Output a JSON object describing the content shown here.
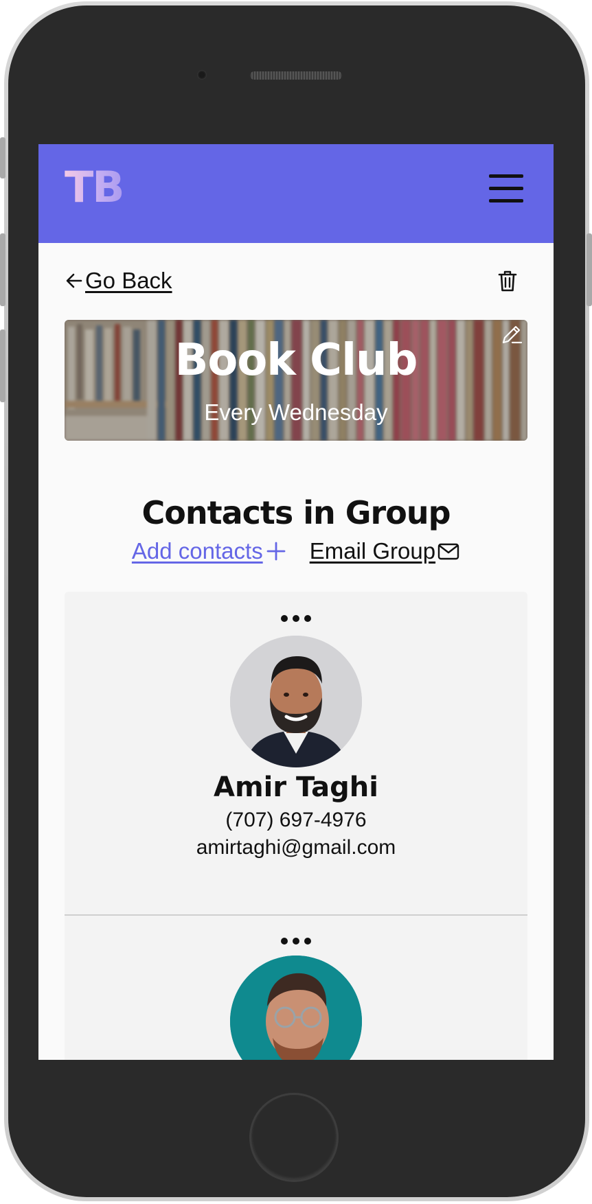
{
  "app": {
    "logo_text": "TB",
    "brand_color": "#6466e6"
  },
  "nav": {
    "back_label": "Go Back",
    "menu_icon": "hamburger-menu-icon",
    "delete_icon": "trash-icon"
  },
  "group": {
    "title": "Book Club",
    "schedule": "Every Wednesday",
    "edit_icon": "pencil-icon"
  },
  "contacts_section": {
    "title": "Contacts in Group",
    "add_label": "Add contacts ",
    "email_label": "Email Group ",
    "add_icon": "plus-icon",
    "email_icon": "envelope-icon"
  },
  "contacts": [
    {
      "name": "Amir Taghi",
      "phone": "(707) 697-4976",
      "email": "amirtaghi@gmail.com",
      "avatar_bg": "#cfcfd3"
    },
    {
      "avatar_bg": "#0f8a8f"
    }
  ]
}
